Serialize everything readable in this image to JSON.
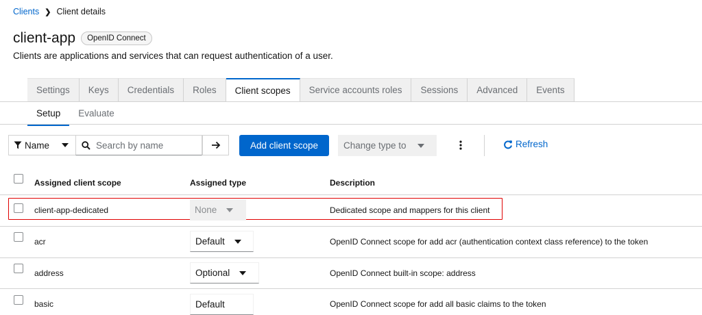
{
  "breadcrumb": {
    "parent": "Clients",
    "current": "Client details"
  },
  "header": {
    "title": "client-app",
    "badge": "OpenID Connect",
    "subtitle": "Clients are applications and services that can request authentication of a user."
  },
  "tabs": [
    "Settings",
    "Keys",
    "Credentials",
    "Roles",
    "Client scopes",
    "Service accounts roles",
    "Sessions",
    "Advanced",
    "Events"
  ],
  "active_tab": "Client scopes",
  "subtabs": [
    "Setup",
    "Evaluate"
  ],
  "toolbar": {
    "filter_label": "Name",
    "search_placeholder": "Search by name",
    "add_button": "Add client scope",
    "change_type": "Change type to",
    "refresh": "Refresh"
  },
  "table": {
    "headers": [
      "Assigned client scope",
      "Assigned type",
      "Description"
    ],
    "rows": [
      {
        "name": "client-app-dedicated",
        "type": "None",
        "description": "Dedicated scope and mappers for this client"
      },
      {
        "name": "acr",
        "type": "Default",
        "description": "OpenID Connect scope for add acr (authentication context class reference) to the token"
      },
      {
        "name": "address",
        "type": "Optional",
        "description": "OpenID Connect built-in scope: address"
      },
      {
        "name": "basic",
        "type": "Default",
        "description": "OpenID Connect scope for add all basic claims to the token"
      }
    ]
  },
  "colors": {
    "accent": "#0066cc",
    "highlight": "#e00000"
  }
}
